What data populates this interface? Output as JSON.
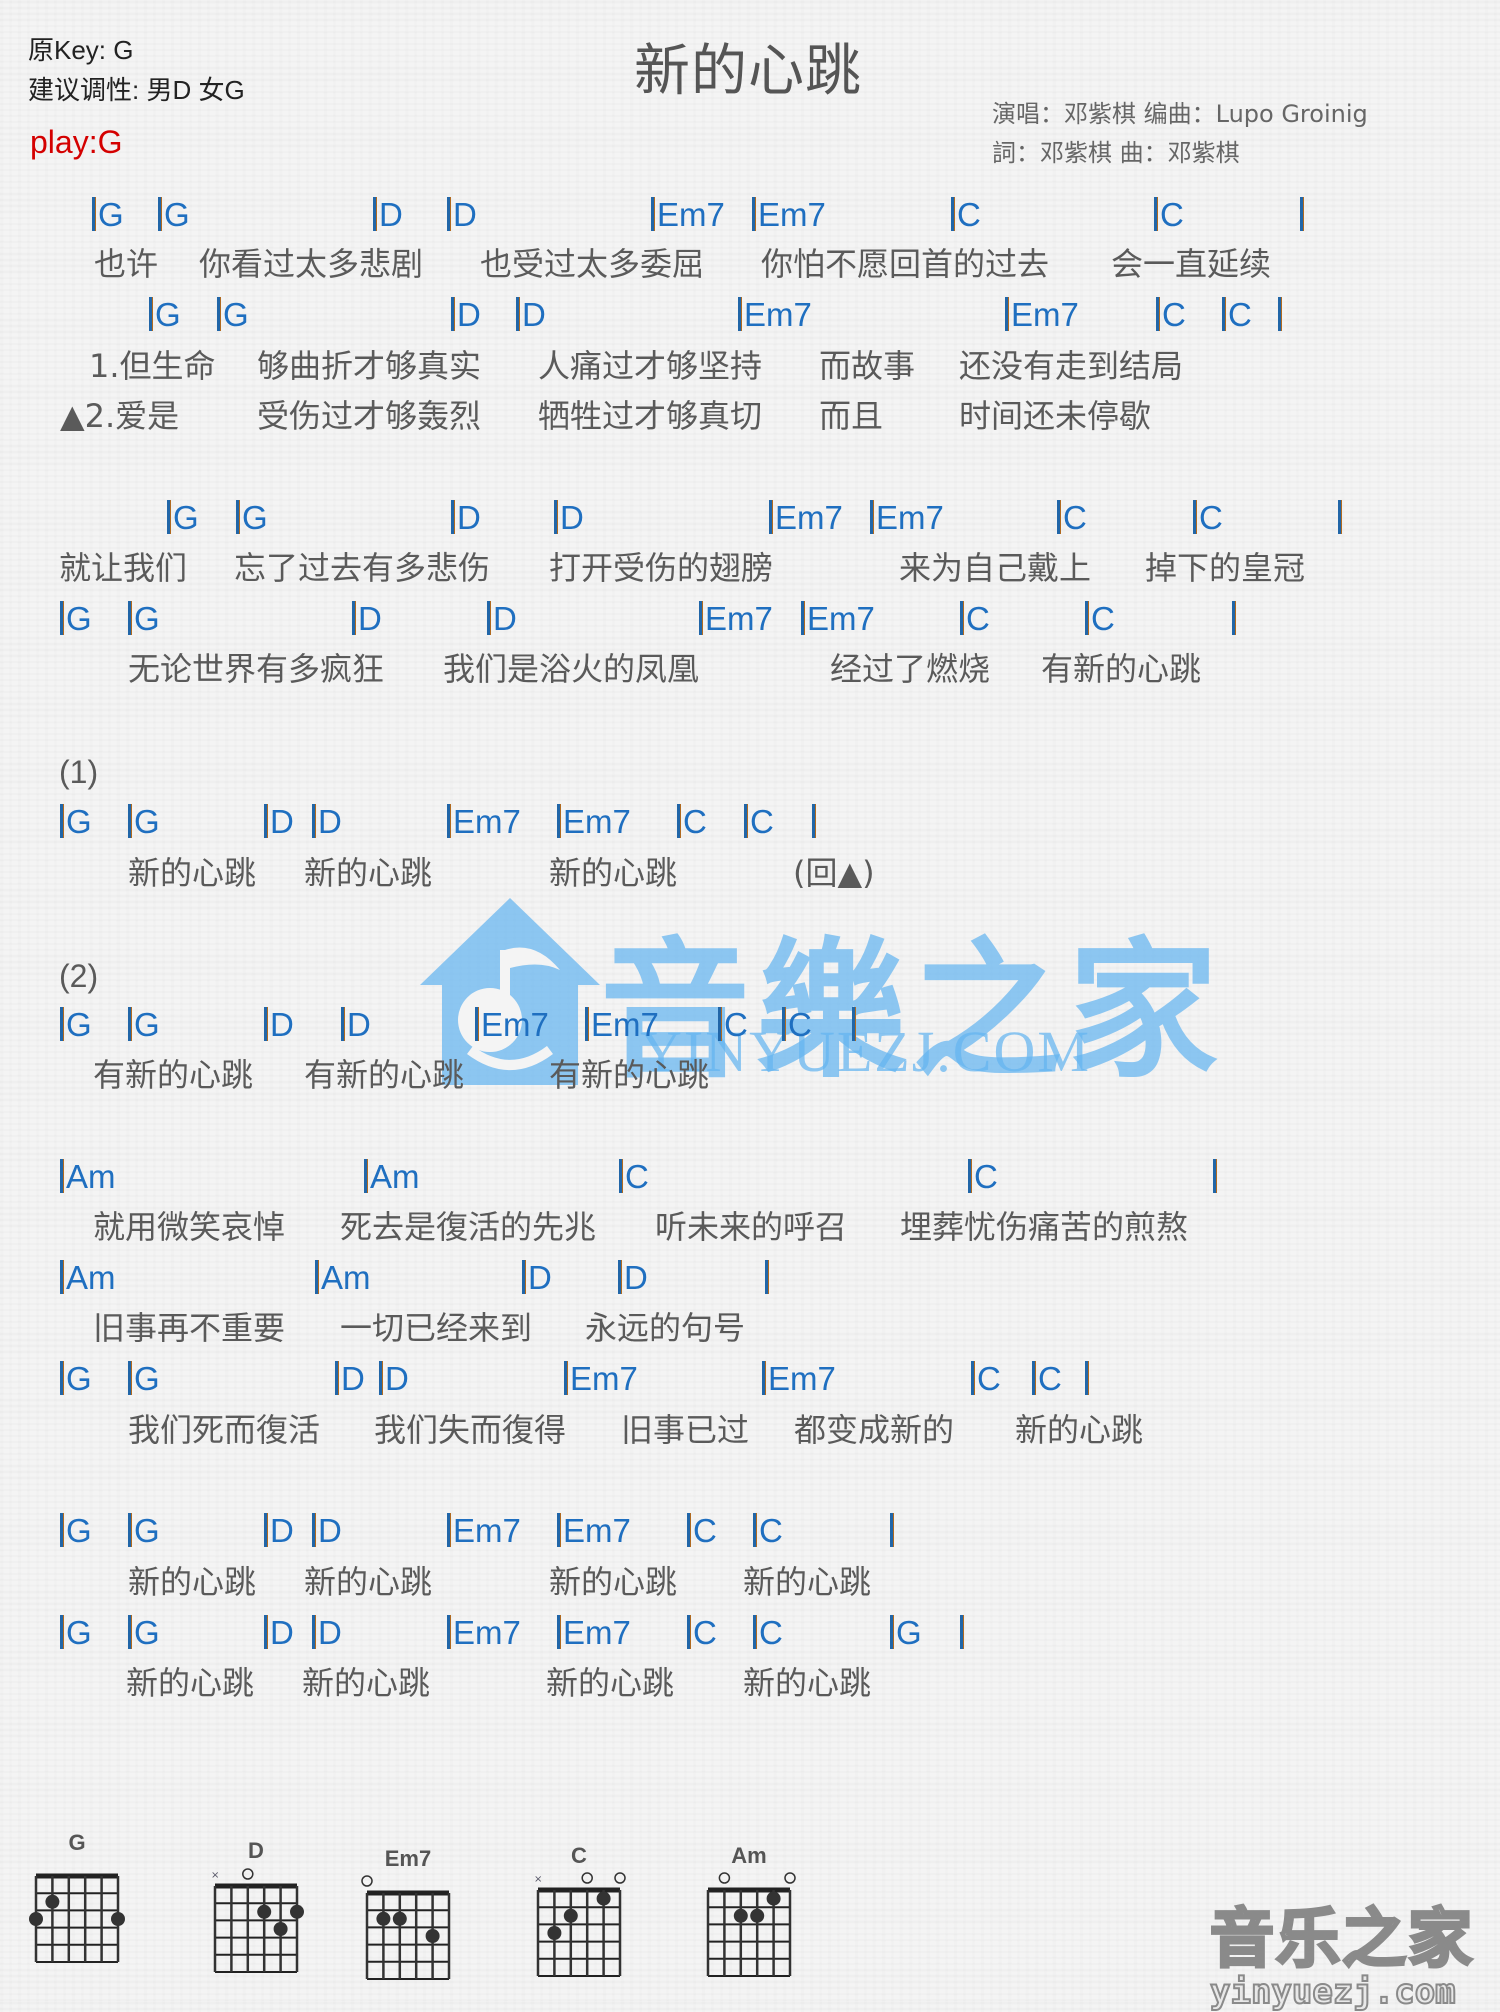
{
  "header": {
    "original_key": "原Key: G",
    "suggested_key": "建议调性: 男D 女G",
    "play_key": "play:G",
    "title": "新的心跳",
    "credit_line1": "演唱：邓紫棋   编曲：Lupo Groinig",
    "credit_line2": "詞：邓紫棋   曲：邓紫棋"
  },
  "colors": {
    "chord": "#1f6fc0",
    "lyric": "#5a5a5a",
    "play_key": "#d40000",
    "watermark": "#64b4f0"
  },
  "sections": {
    "marker1": "(1)",
    "marker2": "(2)"
  },
  "rows": [
    {
      "type": "chord",
      "tokens": [
        "G",
        "G",
        "D",
        "D",
        "Em7",
        "Em7",
        "C",
        "C",
        ""
      ]
    },
    {
      "type": "lyric",
      "tokens": [
        "也许",
        "你看过太多悲剧",
        "也受过太多委屈",
        "你怕不愿回首的过去",
        "会一直延续"
      ]
    },
    {
      "type": "chord",
      "tokens": [
        "G",
        "G",
        "D",
        "D",
        "Em7",
        "Em7",
        "C",
        "C",
        ""
      ]
    },
    {
      "type": "lyric",
      "tokens": [
        "1.但生命",
        "够曲折才够真实",
        "人痛过才够坚持",
        "而故事",
        "还没有走到结局"
      ]
    },
    {
      "type": "lyric",
      "tokens": [
        "▲2.爱是",
        "受伤过才够轰烈",
        "牺牲过才够真切",
        "而且",
        "时间还未停歇"
      ]
    },
    {
      "type": "chord",
      "tokens": [
        "G",
        "G",
        "D",
        "D",
        "Em7",
        "Em7",
        "C",
        "C",
        ""
      ]
    },
    {
      "type": "lyric",
      "tokens": [
        "就让我们",
        "忘了过去有多悲伤",
        "打开受伤的翅膀",
        "来为自己戴上",
        "掉下的皇冠"
      ]
    },
    {
      "type": "chord",
      "tokens": [
        "G",
        "G",
        "D",
        "D",
        "Em7",
        "Em7",
        "C",
        "C",
        ""
      ]
    },
    {
      "type": "lyric",
      "tokens": [
        "无论世界有多疯狂",
        "我们是浴火的凤凰",
        "经过了燃烧",
        "有新的心跳"
      ]
    },
    {
      "type": "chord",
      "tokens": [
        "G",
        "G",
        "D",
        "D",
        "Em7",
        "Em7",
        "C",
        "C",
        ""
      ]
    },
    {
      "type": "lyric",
      "tokens": [
        "新的心跳",
        "新的心跳",
        "新的心跳",
        "(回▲)"
      ]
    },
    {
      "type": "chord",
      "tokens": [
        "G",
        "G",
        "D",
        "D",
        "Em7",
        "Em7",
        "C",
        "C",
        ""
      ]
    },
    {
      "type": "lyric",
      "tokens": [
        "有新的心跳",
        "有新的心跳",
        "有新的心跳"
      ]
    },
    {
      "type": "chord",
      "tokens": [
        "Am",
        "Am",
        "C",
        "C",
        ""
      ]
    },
    {
      "type": "lyric",
      "tokens": [
        "就用微笑哀悼",
        "死去是復活的先兆",
        "听未来的呼召",
        "埋葬忧伤痛苦的煎熬"
      ]
    },
    {
      "type": "chord",
      "tokens": [
        "Am",
        "Am",
        "D",
        "D",
        ""
      ]
    },
    {
      "type": "lyric",
      "tokens": [
        "旧事再不重要",
        "一切已经来到",
        "永远的句号"
      ]
    },
    {
      "type": "chord",
      "tokens": [
        "G",
        "G",
        "D",
        "D",
        "Em7",
        "Em7",
        "C",
        "C",
        ""
      ]
    },
    {
      "type": "lyric",
      "tokens": [
        "我们死而復活",
        "我们失而復得",
        "旧事已过",
        "都变成新的",
        "新的心跳"
      ]
    },
    {
      "type": "chord",
      "tokens": [
        "G",
        "G",
        "D",
        "D",
        "Em7",
        "Em7",
        "C",
        "C",
        ""
      ]
    },
    {
      "type": "lyric",
      "tokens": [
        "新的心跳",
        "新的心跳",
        "新的心跳",
        "新的心跳"
      ]
    },
    {
      "type": "chord",
      "tokens": [
        "G",
        "G",
        "D",
        "D",
        "Em7",
        "Em7",
        "C",
        "C",
        "G",
        ""
      ]
    },
    {
      "type": "lyric",
      "tokens": [
        "新的心跳",
        "新的心跳",
        "新的心跳",
        "新的心跳"
      ]
    }
  ],
  "watermark": {
    "cn": "音樂之家",
    "en": "YINYUEZJ.COM"
  },
  "chord_diagrams": [
    {
      "name": "G",
      "muted": [],
      "open": [],
      "dots": [
        {
          "string": 5,
          "fret": 2
        },
        {
          "string": 6,
          "fret": 3
        },
        {
          "string": 1,
          "fret": 3
        }
      ]
    },
    {
      "name": "D",
      "muted": [
        6
      ],
      "open": [
        4
      ],
      "dots": [
        {
          "string": 3,
          "fret": 2
        },
        {
          "string": 1,
          "fret": 2
        },
        {
          "string": 2,
          "fret": 3
        }
      ]
    },
    {
      "name": "Em7",
      "muted": [],
      "open": [
        6
      ],
      "dots": [
        {
          "string": 5,
          "fret": 2
        },
        {
          "string": 4,
          "fret": 2
        },
        {
          "string": 2,
          "fret": 3
        }
      ]
    },
    {
      "name": "C",
      "muted": [
        6
      ],
      "open": [
        3,
        1
      ],
      "dots": [
        {
          "string": 2,
          "fret": 1
        },
        {
          "string": 4,
          "fret": 2
        },
        {
          "string": 5,
          "fret": 3
        }
      ]
    },
    {
      "name": "Am",
      "muted": [],
      "open": [
        5,
        1
      ],
      "dots": [
        {
          "string": 2,
          "fret": 1
        },
        {
          "string": 4,
          "fret": 2
        },
        {
          "string": 3,
          "fret": 2
        }
      ]
    }
  ],
  "footer_logo": {
    "cn": "音乐之家",
    "en": "yinyuezj.com"
  }
}
